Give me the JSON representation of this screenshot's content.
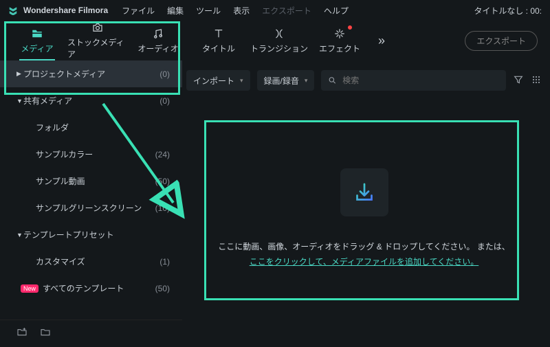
{
  "app": {
    "name": "Wondershare Filmora",
    "title_right": "タイトルなし : 00:"
  },
  "menu": {
    "file": "ファイル",
    "edit": "編集",
    "tool": "ツール",
    "view": "表示",
    "export": "エクスポート",
    "help": "ヘルプ"
  },
  "tabs": {
    "media": "メディア",
    "stock": "ストックメディア",
    "audio": "オーディオ",
    "title": "タイトル",
    "transition": "トランジション",
    "effect": "エフェクト"
  },
  "export_btn": "エクスポート",
  "sidebar": {
    "project": {
      "label": "プロジェクトメディア",
      "count": "(0)"
    },
    "shared": {
      "label": "共有メディア",
      "count": "(0)"
    },
    "folder": {
      "label": "フォルダ",
      "count": ""
    },
    "sample_color": {
      "label": "サンプルカラー",
      "count": "(24)"
    },
    "sample_video": {
      "label": "サンプル動画",
      "count": "(50)"
    },
    "sample_green": {
      "label": "サンプルグリーンスクリーン",
      "count": "(10)"
    },
    "template_preset": {
      "label": "テンプレートプリセット",
      "count": ""
    },
    "customize": {
      "label": "カスタマイズ",
      "count": "(1)"
    },
    "all_templates": {
      "label": "すべてのテンプレート",
      "count": "(50)",
      "badge": "New"
    }
  },
  "controls": {
    "import": "インポート",
    "record": "録画/録音",
    "search_placeholder": "検索"
  },
  "dropzone": {
    "line1": "ここに動画、画像、オーディオをドラッグ & ドロップしてください。 または、",
    "link": "ここをクリックして、メディアファイルを追加してください。"
  }
}
